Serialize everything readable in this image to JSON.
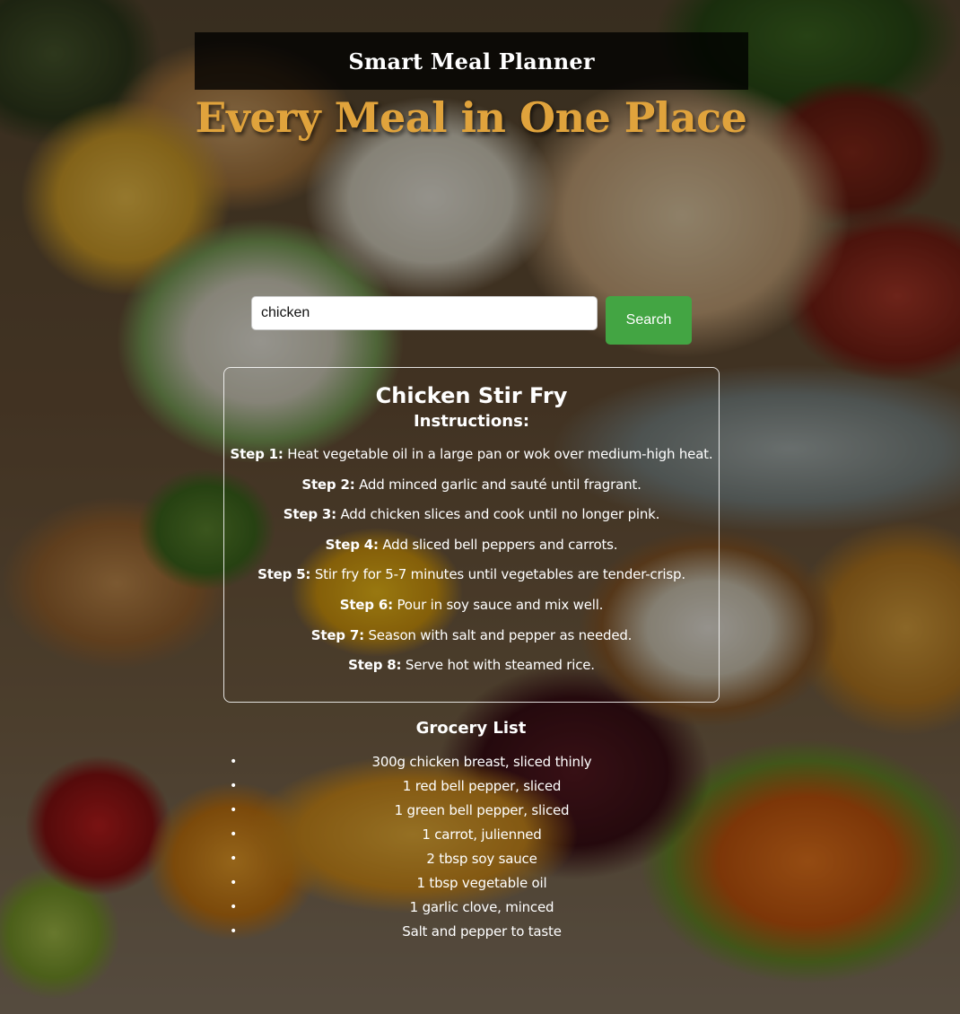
{
  "header": {
    "title": "Smart Meal Planner"
  },
  "hero": {
    "title": "Every Meal in One Place"
  },
  "search": {
    "value": "chicken",
    "button_label": "Search"
  },
  "recipe": {
    "title": "Chicken Stir Fry",
    "instructions_heading": "Instructions:",
    "steps": [
      {
        "label": "Step 1:",
        "text": "Heat vegetable oil in a large pan or wok over medium-high heat."
      },
      {
        "label": "Step 2:",
        "text": "Add minced garlic and sauté until fragrant."
      },
      {
        "label": "Step 3:",
        "text": "Add chicken slices and cook until no longer pink."
      },
      {
        "label": "Step 4:",
        "text": "Add sliced bell peppers and carrots."
      },
      {
        "label": "Step 5:",
        "text": "Stir fry for 5-7 minutes until vegetables are tender-crisp."
      },
      {
        "label": "Step 6:",
        "text": "Pour in soy sauce and mix well."
      },
      {
        "label": "Step 7:",
        "text": "Season with salt and pepper as needed."
      },
      {
        "label": "Step 8:",
        "text": "Serve hot with steamed rice."
      }
    ]
  },
  "grocery": {
    "heading": "Grocery List",
    "items": [
      "300g chicken breast, sliced thinly",
      "1 red bell pepper, sliced",
      "1 green bell pepper, sliced",
      "1 carrot, julienned",
      "2 tbsp soy sauce",
      "1 tbsp vegetable oil",
      "1 garlic clove, minced",
      "Salt and pepper to taste"
    ]
  },
  "colors": {
    "hero_gold": "#e0a33c",
    "search_button_green": "#43a543",
    "header_bar": "#000000"
  }
}
